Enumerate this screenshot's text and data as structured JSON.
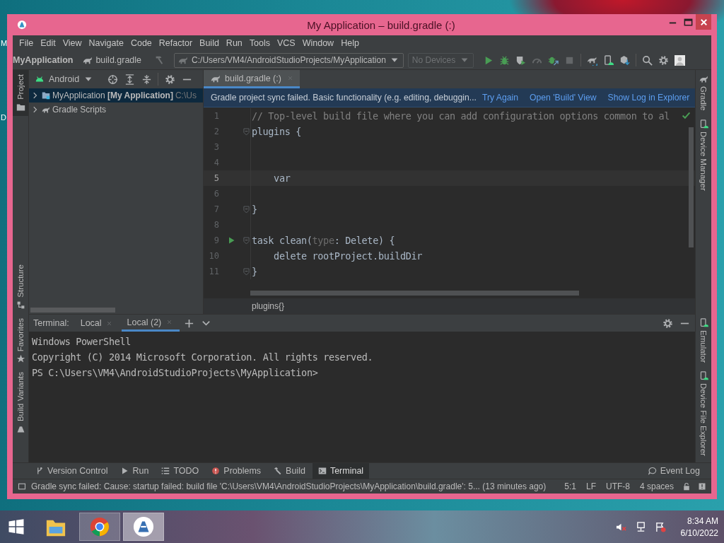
{
  "desktop": {
    "edge_labels": [
      "M",
      "D"
    ]
  },
  "window": {
    "title": "My Application – build.gradle (:)"
  },
  "menu": [
    "File",
    "Edit",
    "View",
    "Navigate",
    "Code",
    "Refactor",
    "Build",
    "Run",
    "Tools",
    "VCS",
    "Window",
    "Help"
  ],
  "navbar": {
    "breadcrumbs": [
      {
        "label": "MyApplication",
        "kind": "project"
      },
      {
        "label": "build.gradle",
        "kind": "gradle"
      }
    ],
    "run_config": "C:/Users/VM4/AndroidStudioProjects/MyApplication",
    "device": "No Devices"
  },
  "toolbar": [
    {
      "kind": "run",
      "disabled": false
    },
    {
      "kind": "debug",
      "disabled": false
    },
    {
      "kind": "coverage",
      "disabled": false
    },
    {
      "kind": "profiler",
      "disabled": true
    },
    {
      "kind": "attach",
      "disabled": false
    },
    {
      "kind": "stop",
      "disabled": true
    },
    {
      "kind": "sync",
      "disabled": false
    },
    {
      "kind": "device",
      "disabled": false
    },
    {
      "kind": "sdk",
      "disabled": false
    },
    {
      "kind": "search",
      "disabled": false
    },
    {
      "kind": "settings",
      "disabled": false
    },
    {
      "kind": "avatar",
      "disabled": false
    }
  ],
  "left_stripe": {
    "upper": [
      {
        "label": "Project",
        "kind": "project",
        "selected": true
      }
    ],
    "upper_end": [
      {
        "label": "Structure",
        "kind": "structure",
        "selected": false
      }
    ],
    "lower": [
      {
        "label": "Favorites",
        "kind": "favorites",
        "selected": false
      },
      {
        "label": "Build Variants",
        "kind": "variants",
        "selected": false
      }
    ]
  },
  "right_stripe": {
    "upper": [
      {
        "label": "Gradle",
        "kind": "gradle",
        "selected": false
      },
      {
        "label": "Device Manager",
        "kind": "device",
        "selected": false
      }
    ],
    "lower": [
      {
        "label": "Emulator",
        "kind": "device",
        "selected": false
      },
      {
        "label": "Device File Explorer",
        "kind": "device",
        "selected": false
      }
    ]
  },
  "project_panel": {
    "view": "Android",
    "tree": [
      {
        "label": "MyApplication",
        "bold_label": "[My Application]",
        "path": "C:\\Us",
        "kind": "module",
        "expanded": false,
        "selected": true
      },
      {
        "label": "Gradle Scripts",
        "kind": "gradle",
        "expanded": false,
        "selected": false
      }
    ]
  },
  "editor": {
    "tabs": [
      {
        "label": "build.gradle (:)",
        "selected": true
      }
    ],
    "banner": {
      "message": "Gradle project sync failed. Basic functionality (e.g. editing, debuggin...",
      "links": [
        "Try Again",
        "Open 'Build' View",
        "Show Log in Explorer"
      ]
    },
    "lines": [
      {
        "number": "1",
        "tokens": [
          {
            "text": "// Top-level build file where you can add configuration options common to al",
            "kind": "comment"
          }
        ],
        "current": false,
        "run_marker": false,
        "fold": false
      },
      {
        "number": "2",
        "tokens": [
          {
            "text": "plugins {",
            "kind": "plain"
          }
        ],
        "current": false,
        "run_marker": false,
        "fold": true
      },
      {
        "number": "3",
        "current": false,
        "run_marker": false,
        "fold": false
      },
      {
        "number": "4",
        "current": false,
        "run_marker": false,
        "fold": false
      },
      {
        "number": "5",
        "tokens": [
          {
            "text": "    var",
            "kind": "plain"
          }
        ],
        "current": true,
        "run_marker": false,
        "fold": false
      },
      {
        "number": "6",
        "current": false,
        "run_marker": false,
        "fold": false
      },
      {
        "number": "7",
        "tokens": [
          {
            "text": "}",
            "kind": "plain"
          }
        ],
        "current": false,
        "run_marker": false,
        "fold": true
      },
      {
        "number": "8",
        "current": false,
        "run_marker": false,
        "fold": false
      },
      {
        "number": "9",
        "tokens": [
          {
            "text": "task clean(",
            "kind": "plain"
          },
          {
            "text": "type",
            "kind": "param"
          },
          {
            "text": ": Delete) {",
            "kind": "plain"
          }
        ],
        "current": false,
        "run_marker": true,
        "fold": true
      },
      {
        "number": "10",
        "tokens": [
          {
            "text": "    delete rootProject.buildDir",
            "kind": "plain"
          }
        ],
        "current": false,
        "run_marker": false,
        "fold": false
      },
      {
        "number": "11",
        "tokens": [
          {
            "text": "}",
            "kind": "plain"
          }
        ],
        "current": false,
        "run_marker": false,
        "fold": true
      }
    ],
    "breadcrumb": "plugins{}"
  },
  "terminal": {
    "label": "Terminal:",
    "tabs": [
      {
        "label": "Local",
        "selected": false
      },
      {
        "label": "Local (2)",
        "selected": true
      }
    ],
    "lines": [
      "Windows PowerShell",
      "Copyright (C) 2014 Microsoft Corporation. All rights reserved.",
      "PS C:\\Users\\VM4\\AndroidStudioProjects\\MyApplication>"
    ]
  },
  "tool_windows": [
    {
      "label": "Version Control",
      "kind": "vcs",
      "selected": false
    },
    {
      "label": "Run",
      "kind": "run",
      "selected": false
    },
    {
      "label": "TODO",
      "kind": "todo",
      "selected": false
    },
    {
      "label": "Problems",
      "kind": "problems",
      "selected": false
    },
    {
      "label": "Build",
      "kind": "build",
      "selected": false
    },
    {
      "label": "Terminal",
      "kind": "terminal",
      "selected": true
    }
  ],
  "event_log": "Event Log",
  "status_bar": {
    "message": "Gradle sync failed: Cause: startup failed: build file 'C:\\Users\\VM4\\AndroidStudioProjects\\MyApplication\\build.gradle': 5... (13 minutes ago)",
    "items": [
      "5:1",
      "LF",
      "UTF-8",
      "4 spaces"
    ]
  },
  "taskbar": {
    "apps": [
      {
        "kind": "explorer",
        "open": false,
        "selected": false
      },
      {
        "kind": "browser",
        "open": true,
        "selected": false
      },
      {
        "kind": "studio",
        "open": true,
        "selected": true
      }
    ],
    "time": "8:34 AM",
    "date": "6/10/2022"
  }
}
